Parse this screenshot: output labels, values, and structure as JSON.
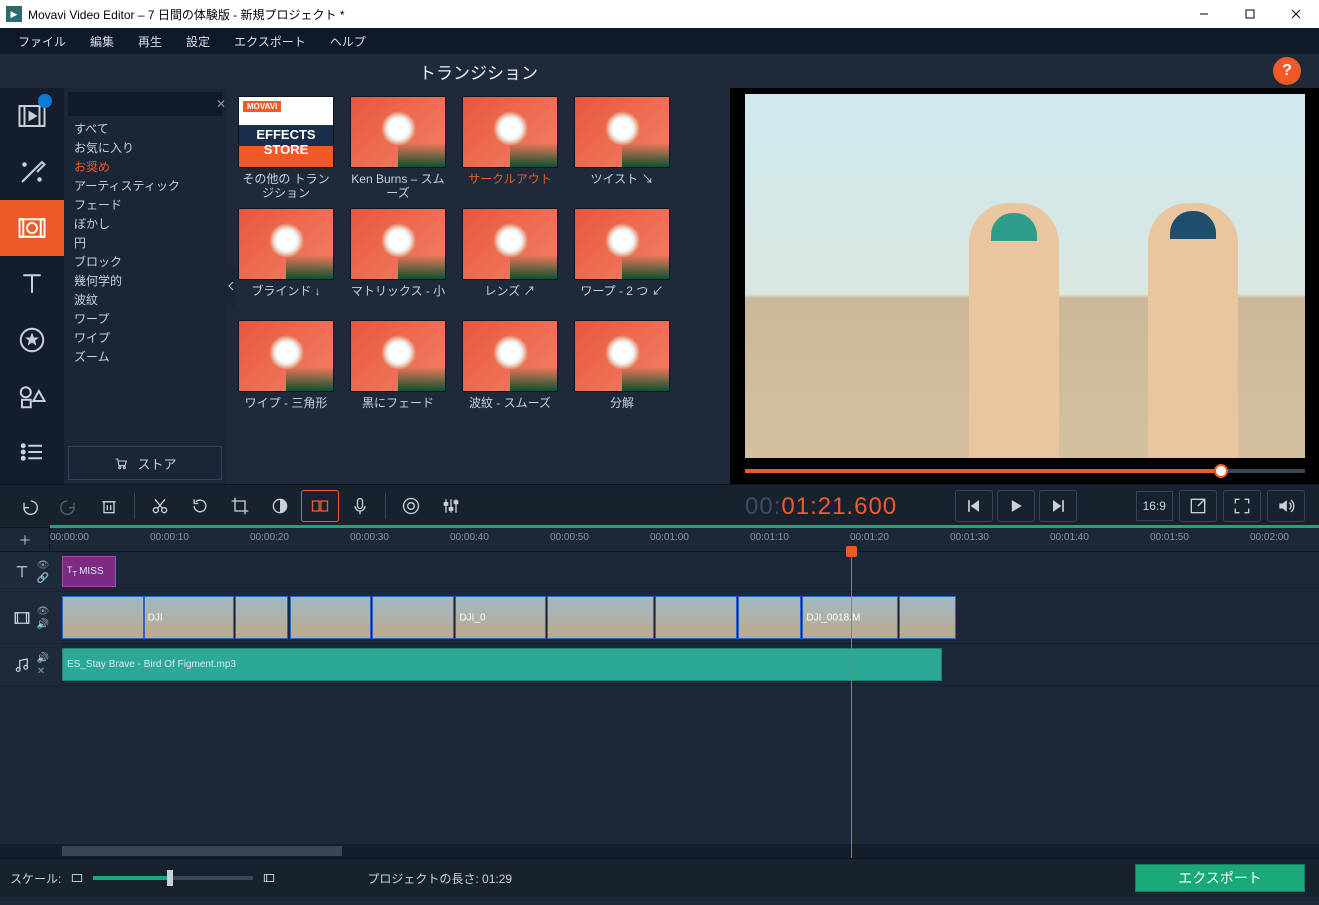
{
  "titlebar": {
    "title": "Movavi Video Editor – 7 日間の体験版 - 新規プロジェクト *"
  },
  "menubar": {
    "items": [
      "ファイル",
      "編集",
      "再生",
      "設定",
      "エクスポート",
      "ヘルプ"
    ]
  },
  "panel": {
    "title": "トランジション"
  },
  "help": {
    "label": "?"
  },
  "categories": {
    "search_placeholder": "",
    "items": [
      "すべて",
      "お気に入り",
      "お奨め",
      "アーティスティック",
      "フェード",
      "ぼかし",
      "円",
      "ブロック",
      "幾何学的",
      "波紋",
      "ワープ",
      "ワイプ",
      "ズーム"
    ],
    "selected_index": 2,
    "store_label": "ストア"
  },
  "transitions": {
    "items": [
      {
        "label": "その他の トランジション",
        "store": true
      },
      {
        "label": "Ken Burns – スムーズ"
      },
      {
        "label": "サークルアウト",
        "selected": true
      },
      {
        "label": "ツイスト ↘"
      },
      {
        "label": "ブラインド ↓"
      },
      {
        "label": "マトリックス - 小"
      },
      {
        "label": "レンズ ↗"
      },
      {
        "label": "ワープ - 2 つ ↙"
      },
      {
        "label": "ワイプ - 三角形"
      },
      {
        "label": "黒にフェード"
      },
      {
        "label": "波紋 - スムーズ"
      },
      {
        "label": "分解"
      }
    ],
    "store_brand": "MOVAVI",
    "store_text1": "EFFECTS",
    "store_text2": "STORE"
  },
  "timecode": {
    "gray": "00:",
    "orange": "01:21.600"
  },
  "aspect": {
    "label": "16:9"
  },
  "ruler": {
    "marks": [
      "00:00:00",
      "00:00:10",
      "00:00:20",
      "00:00:30",
      "00:00:40",
      "00:00:50",
      "00:01:00",
      "00:01:10",
      "00:01:20",
      "00:01:30",
      "00:01:40",
      "00:01:50",
      "00:02:00"
    ]
  },
  "tracks": {
    "title_clip": "MISS",
    "video_clips": [
      {
        "label": "",
        "l": 0,
        "w": 6.5
      },
      {
        "label": "DJI",
        "l": 6.5,
        "w": 7.2
      },
      {
        "label": "",
        "l": 13.8,
        "w": 4.2
      },
      {
        "label": "",
        "l": 18.1,
        "w": 6.5
      },
      {
        "label": "",
        "l": 24.7,
        "w": 6.5
      },
      {
        "label": "DJI_0",
        "l": 31.3,
        "w": 7.2
      },
      {
        "label": "",
        "l": 38.6,
        "w": 8.5
      },
      {
        "label": "",
        "l": 47.2,
        "w": 6.5
      },
      {
        "label": "",
        "l": 53.8,
        "w": 5.0
      },
      {
        "label": "DJI_0018.M",
        "l": 58.9,
        "w": 7.6
      },
      {
        "label": "",
        "l": 66.6,
        "w": 4.5
      }
    ],
    "audio_clip": {
      "label": "ES_Stay Brave - Bird Of Figment.mp3",
      "l": 0,
      "w": 70
    }
  },
  "bottombar": {
    "scale_label": "スケール:",
    "project_length_label": "プロジェクトの長さ:",
    "project_length_value": "01:29",
    "export_label": "エクスポート"
  }
}
